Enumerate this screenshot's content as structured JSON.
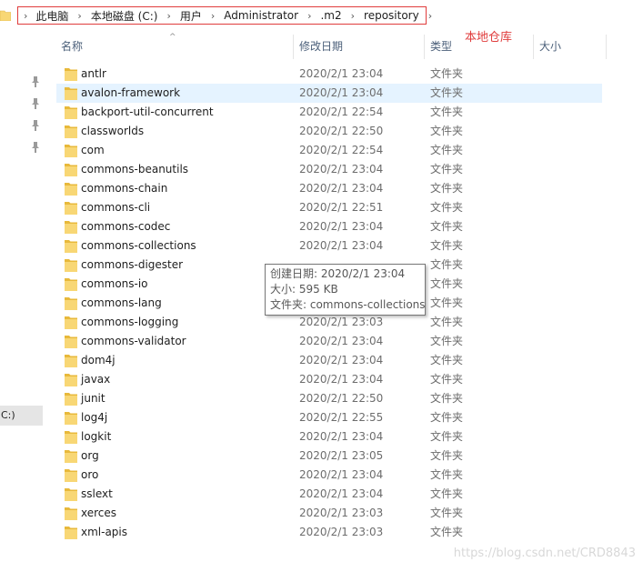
{
  "breadcrumb": {
    "items": [
      "此电脑",
      "本地磁盘 (C:)",
      "用户",
      "Administrator",
      ".m2",
      "repository"
    ],
    "separator": "›"
  },
  "annotation": {
    "label": "本地仓库",
    "color": "#e03c3c"
  },
  "columns": {
    "name": "名称",
    "date": "修改日期",
    "type": "类型",
    "size": "大小"
  },
  "nav": {
    "selected_label": "C:)"
  },
  "files": [
    {
      "name": "antlr",
      "date": "2020/2/1 23:04",
      "type": "文件夹"
    },
    {
      "name": "avalon-framework",
      "date": "2020/2/1 23:04",
      "type": "文件夹"
    },
    {
      "name": "backport-util-concurrent",
      "date": "2020/2/1 22:54",
      "type": "文件夹"
    },
    {
      "name": "classworlds",
      "date": "2020/2/1 22:50",
      "type": "文件夹"
    },
    {
      "name": "com",
      "date": "2020/2/1 22:54",
      "type": "文件夹"
    },
    {
      "name": "commons-beanutils",
      "date": "2020/2/1 23:04",
      "type": "文件夹"
    },
    {
      "name": "commons-chain",
      "date": "2020/2/1 23:04",
      "type": "文件夹"
    },
    {
      "name": "commons-cli",
      "date": "2020/2/1 22:51",
      "type": "文件夹"
    },
    {
      "name": "commons-codec",
      "date": "2020/2/1 23:04",
      "type": "文件夹"
    },
    {
      "name": "commons-collections",
      "date": "2020/2/1 23:04",
      "type": "文件夹"
    },
    {
      "name": "commons-digester",
      "date": "",
      "type": "文件夹"
    },
    {
      "name": "commons-io",
      "date": "",
      "type": "文件夹"
    },
    {
      "name": "commons-lang",
      "date": "",
      "type": "文件夹"
    },
    {
      "name": "commons-logging",
      "date": "2020/2/1 23:03",
      "type": "文件夹"
    },
    {
      "name": "commons-validator",
      "date": "2020/2/1 23:04",
      "type": "文件夹"
    },
    {
      "name": "dom4j",
      "date": "2020/2/1 23:04",
      "type": "文件夹"
    },
    {
      "name": "javax",
      "date": "2020/2/1 23:04",
      "type": "文件夹"
    },
    {
      "name": "junit",
      "date": "2020/2/1 22:50",
      "type": "文件夹"
    },
    {
      "name": "log4j",
      "date": "2020/2/1 22:55",
      "type": "文件夹"
    },
    {
      "name": "logkit",
      "date": "2020/2/1 23:04",
      "type": "文件夹"
    },
    {
      "name": "org",
      "date": "2020/2/1 23:05",
      "type": "文件夹"
    },
    {
      "name": "oro",
      "date": "2020/2/1 23:04",
      "type": "文件夹"
    },
    {
      "name": "sslext",
      "date": "2020/2/1 23:04",
      "type": "文件夹"
    },
    {
      "name": "xerces",
      "date": "2020/2/1 23:03",
      "type": "文件夹"
    },
    {
      "name": "xml-apis",
      "date": "2020/2/1 23:03",
      "type": "文件夹"
    }
  ],
  "hover_index": 1,
  "tooltip": {
    "created": "创建日期: 2020/2/1 23:04",
    "size": "大小: 595 KB",
    "folders": "文件夹: commons-collections"
  },
  "watermark": "https://blog.csdn.net/CRD8843",
  "colors": {
    "folder": "#f8d775",
    "folder_dark": "#e8b93b",
    "hover_row": "#e5f3ff",
    "header_text": "#4c607a"
  }
}
